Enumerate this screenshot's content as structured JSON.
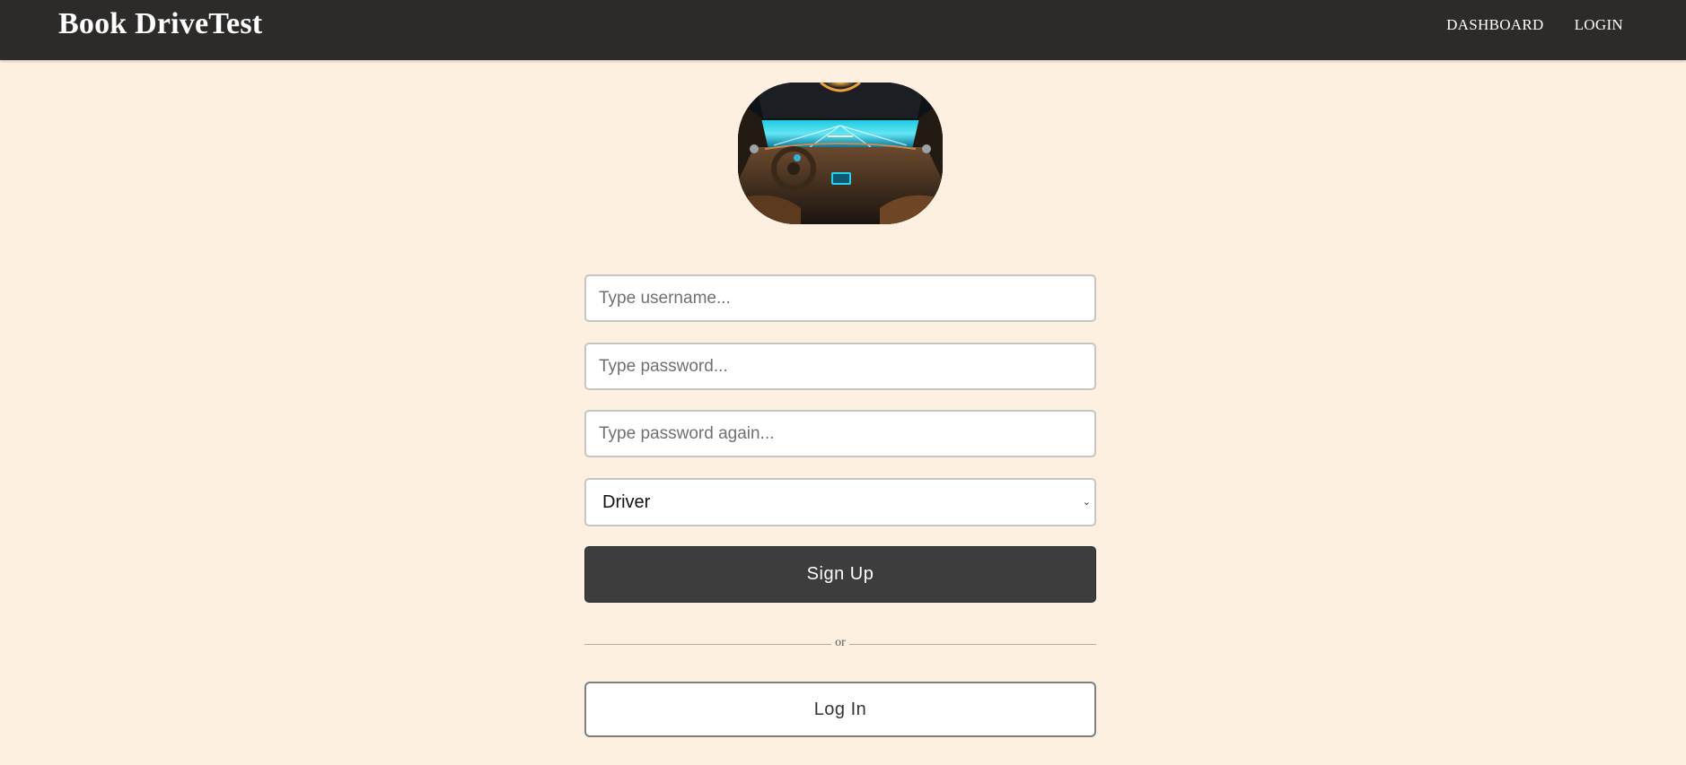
{
  "navbar": {
    "brand": "Book DriveTest",
    "links": [
      {
        "label": "DASHBOARD"
      },
      {
        "label": "LOGIN"
      }
    ]
  },
  "hero": {
    "icon": "car-interior-photo"
  },
  "form": {
    "username_placeholder": "Type username...",
    "password_placeholder": "Type password...",
    "password_again_placeholder": "Type password again...",
    "user_type": {
      "selected": "Driver"
    },
    "signup_label": "Sign Up",
    "divider_text": "or",
    "login_label": "Log In"
  },
  "colors": {
    "background": "#fdf0e0",
    "navbar": "#2d2b29",
    "primary_button": "#3d3d3d"
  }
}
